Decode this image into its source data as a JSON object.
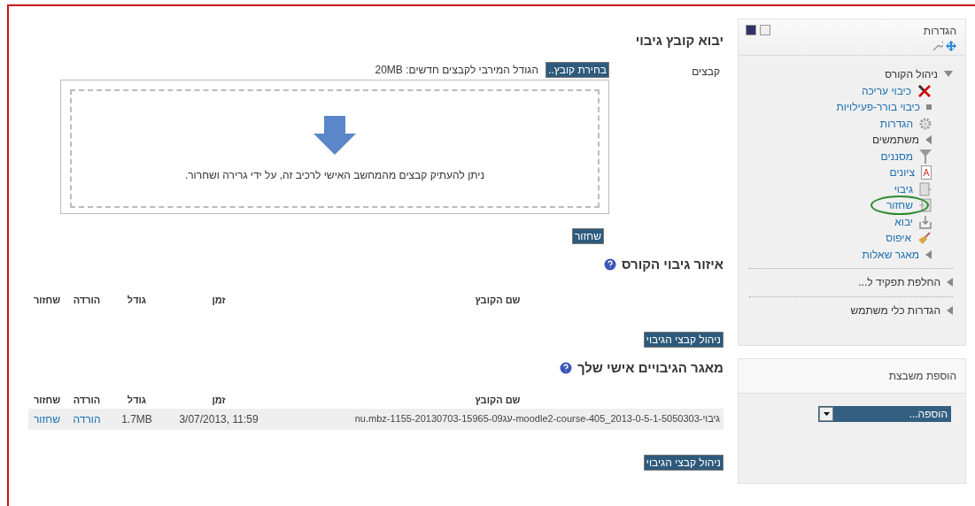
{
  "main": {
    "title": "יבוא קובץ גיבוי",
    "files_label": "קבצים",
    "choose_button": "בחירת קובץ..",
    "max_size": "הגודל המירבי לקבצים חדשים: 20MB",
    "drop_hint": "ניתן להעתיק קבצים מהמחשב האישי לרכיב זה, על ידי גרירה ושחרור.",
    "restore_button": "שחזור",
    "sections": [
      {
        "title": "איזור גיבוי הקורס",
        "columns": [
          "שם הקובץ",
          "זמן",
          "גודל",
          "הורדה",
          "שחזור"
        ],
        "manage_button": "ניהול קבצי הגיבוי"
      },
      {
        "title": "מאגר הגיבויים אישי שלך",
        "columns": [
          "שם הקובץ",
          "זמן",
          "גודל",
          "הורדה",
          "שחזור"
        ],
        "rows": [
          {
            "cells": [
              "גיבוי-1-5050303-moodle2-course-405_2013-0-5-עג1155-20130703-15965-09-nu.mbz",
              "11:59 ,3/07/2013",
              "1.7MB",
              "הורדה",
              "שחזור"
            ]
          }
        ],
        "manage_button": "ניהול קבצי הגיבוי"
      }
    ]
  },
  "sidebar": {
    "settings_title": "הגדרות",
    "tree": [
      {
        "label": "ניהול הקורס",
        "kind": "branch",
        "expanded": true,
        "children": [
          {
            "label": "כיבוי עריכה",
            "kind": "tools",
            "link": true,
            "highlighted": false
          },
          {
            "label": "כיבוי בורר-פעילויות",
            "kind": "bullet",
            "link": true,
            "highlighted": false
          },
          {
            "label": "הגדרות",
            "kind": "gear",
            "link": true,
            "highlighted": false
          },
          {
            "label": "משתמשים",
            "kind": "branch",
            "link": false,
            "highlighted": false
          },
          {
            "label": "מסננים",
            "kind": "filter",
            "link": true,
            "highlighted": false
          },
          {
            "label": "ציונים",
            "kind": "grades",
            "link": true,
            "highlighted": false
          },
          {
            "label": "גיבוי",
            "kind": "backup",
            "link": true,
            "highlighted": false
          },
          {
            "label": "שחזור",
            "kind": "restore",
            "link": true,
            "highlighted": true
          },
          {
            "label": "יבוא",
            "kind": "import",
            "link": true,
            "highlighted": false
          },
          {
            "label": "איפוס",
            "kind": "reset",
            "link": true,
            "highlighted": false
          },
          {
            "label": "מאגר שאלות",
            "kind": "branch",
            "link": true,
            "highlighted": false
          }
        ]
      },
      {
        "label": "החלפת תפקיד ל...",
        "kind": "branch",
        "expanded": false
      },
      {
        "label": "הגדרות כלי משתמש",
        "kind": "branch",
        "expanded": false
      }
    ],
    "add_block_title": "הוספת משבצת",
    "add_select": "הוספה..."
  }
}
